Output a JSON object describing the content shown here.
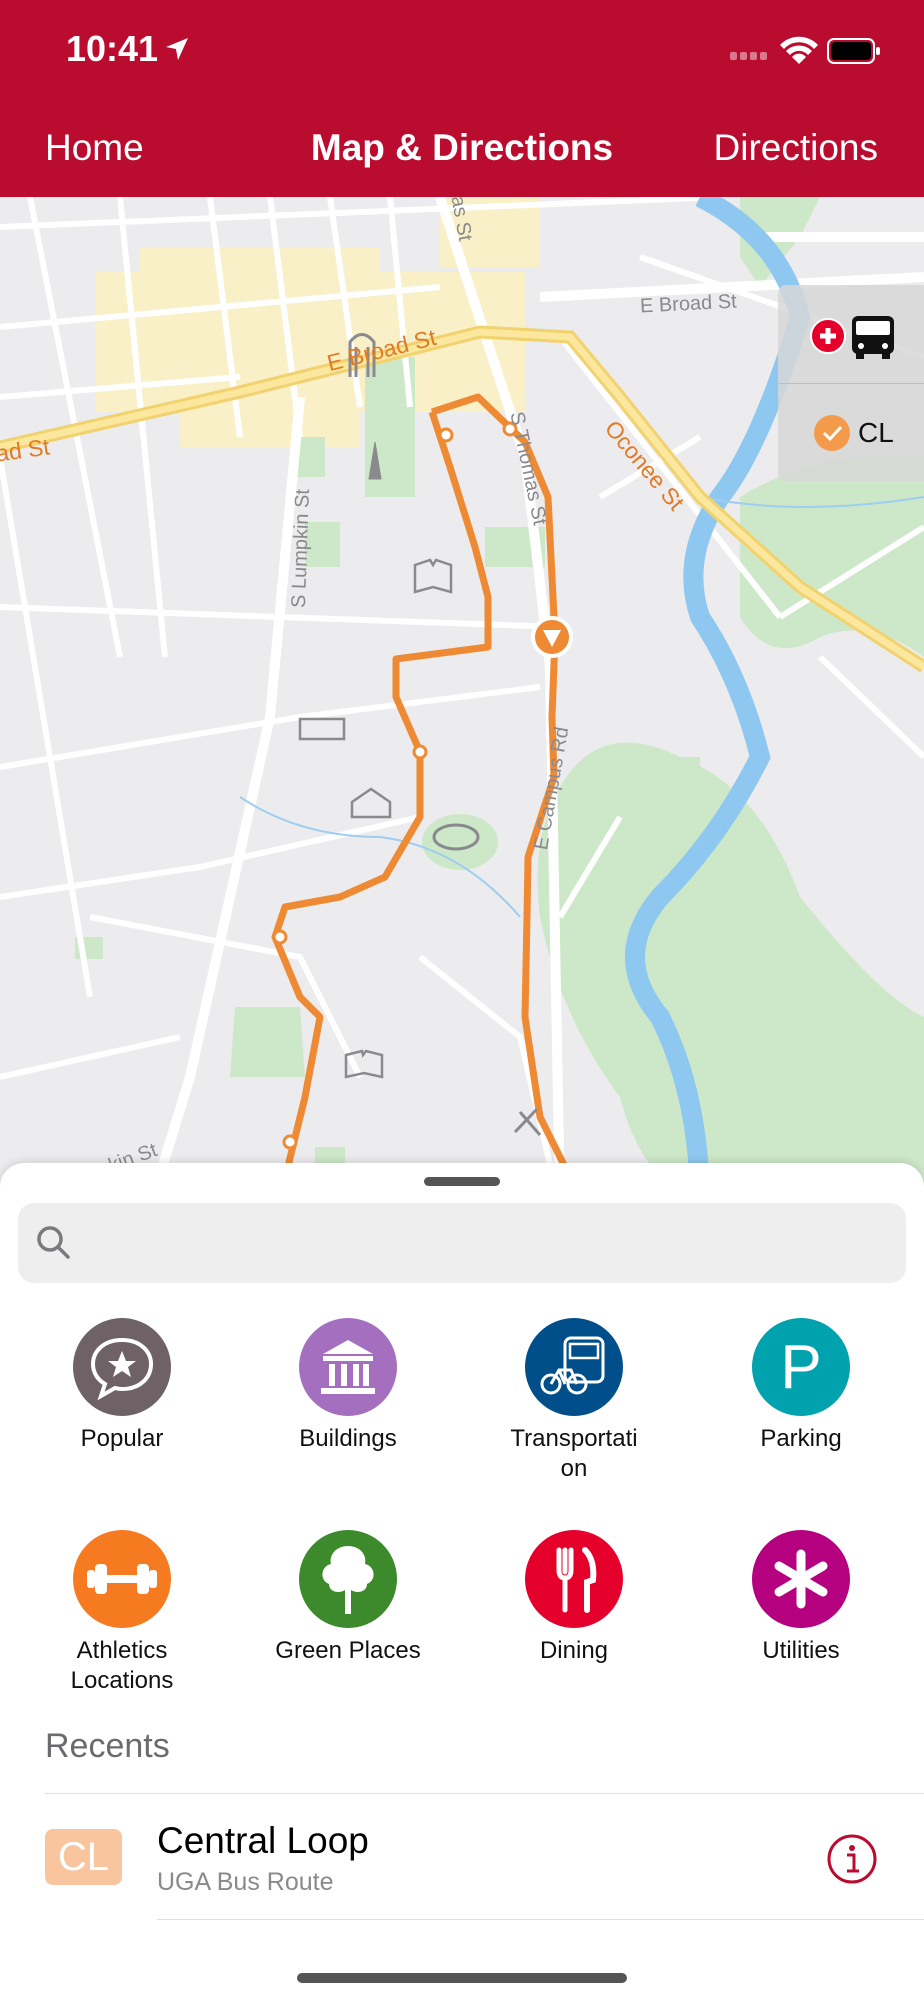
{
  "status": {
    "time": "10:41"
  },
  "nav": {
    "left": "Home",
    "title": "Map & Directions",
    "right": "Directions"
  },
  "map": {
    "streets": {
      "e_broad_upper": "E Broad St",
      "e_broad_main": "E Broad St",
      "broad_left": "ad St",
      "oconee": "Oconee St",
      "s_lumpkin": "S Lumpkin St",
      "s_thomas": "S Thomas St",
      "e_campus": "E Campus Rd",
      "thomas_top": "as St",
      "bottom_left": "kin St"
    },
    "route_panel": {
      "route_label": "CL"
    }
  },
  "search": {
    "placeholder": ""
  },
  "categories": [
    {
      "label": "Popular",
      "color": "#6E6266",
      "icon": "star-chat-icon"
    },
    {
      "label": "Buildings",
      "color": "#A56FBF",
      "icon": "building-icon"
    },
    {
      "label": "Transportati\non",
      "color": "#004E8A",
      "icon": "bus-bike-icon"
    },
    {
      "label": "Parking",
      "color": "#00A3AD",
      "icon": "parking-icon"
    },
    {
      "label": "Athletics\nLocations",
      "color": "#F57A20",
      "icon": "dumbbell-icon"
    },
    {
      "label": "Green Places",
      "color": "#3D8A2D",
      "icon": "tree-icon"
    },
    {
      "label": "Dining",
      "color": "#E4002B",
      "icon": "fork-knife-icon"
    },
    {
      "label": "Utilities",
      "color": "#B5007F",
      "icon": "asterisk-icon"
    }
  ],
  "recents": {
    "title": "Recents",
    "items": [
      {
        "badge": "CL",
        "title": "Central Loop",
        "subtitle": "UGA Bus Route"
      }
    ]
  },
  "colors": {
    "brand_red": "#BA0C2F",
    "route_orange": "#EE8A33"
  }
}
